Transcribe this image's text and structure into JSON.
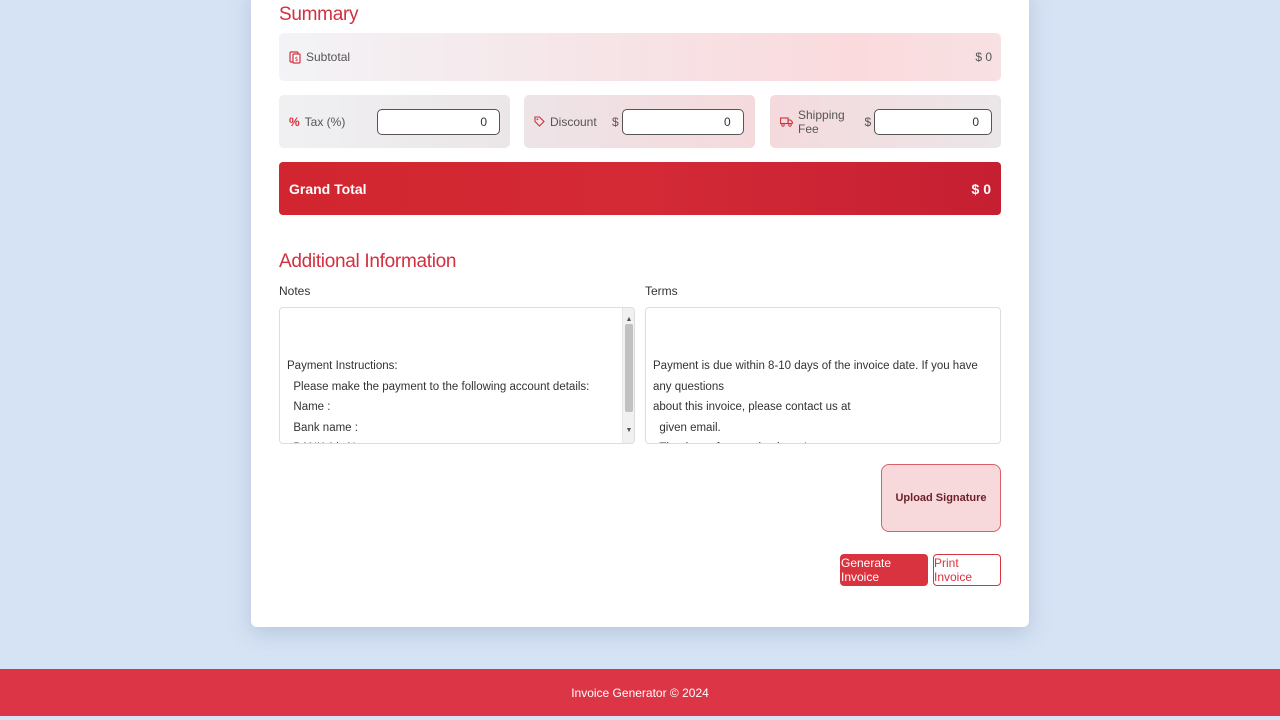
{
  "summary": {
    "title": "Summary",
    "subtotal_label": "Subtotal",
    "subtotal_value": "$ 0",
    "tax_label": "Tax (%)",
    "tax_value": "0",
    "discount_label": "Discount",
    "discount_currency": "$",
    "discount_value": "0",
    "shipping_label": "Shipping Fee",
    "shipping_currency": "$",
    "shipping_value": "0",
    "grand_total_label": "Grand Total",
    "grand_total_value": "$ 0"
  },
  "additional": {
    "title": "Additional Information",
    "notes_label": "Notes",
    "notes_value": "Payment Instructions:\n  Please make the payment to the following account details:\n  Name :\n  Bank name :\n  BANK A/c No:\n  RTGS/NEFT- IFSC:",
    "terms_label": "Terms",
    "terms_value": "Payment is due within 8-10 days of the invoice date. If you have any questions\nabout this invoice, please contact us at\n  given email.\n  Thank you for your business!"
  },
  "actions": {
    "upload_signature": "Upload Signature",
    "generate_invoice": "Generate Invoice",
    "print_invoice": "Print Invoice"
  },
  "footer": {
    "text": "Invoice Generator © 2024"
  },
  "colors": {
    "accent": "#dc3545",
    "background": "#d6e3f5"
  }
}
